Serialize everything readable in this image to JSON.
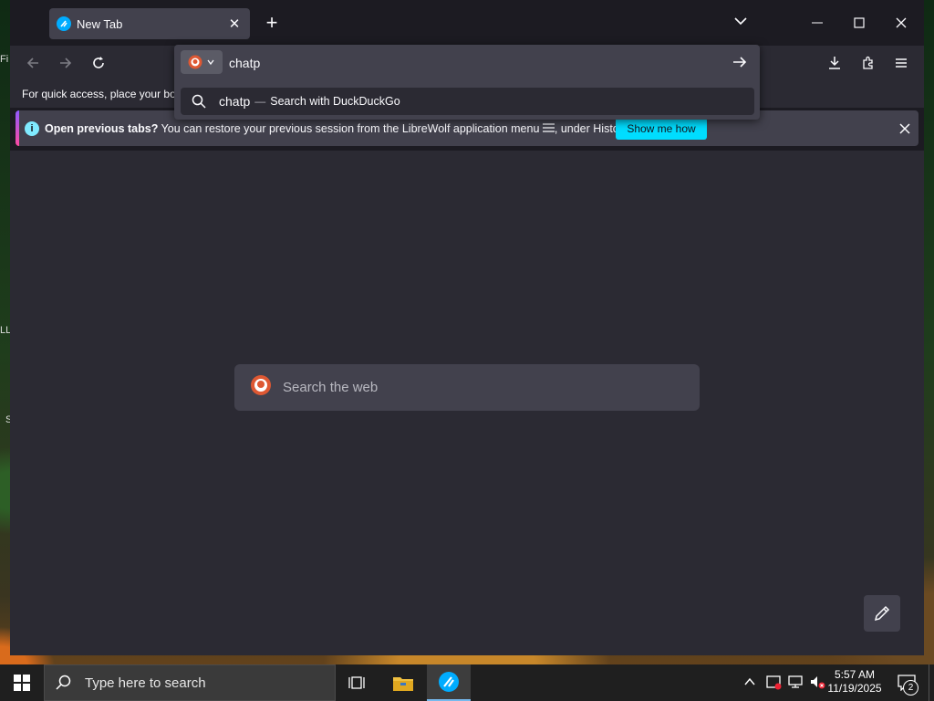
{
  "desktop": {
    "edge_text_1": "Fi",
    "edge_text_2": "LL",
    "edge_text_3": "S"
  },
  "browser": {
    "tab": {
      "title": "New Tab"
    },
    "bookmarks_hint": "For quick access, place your boo",
    "urlbar": {
      "value": "chatp",
      "suggestion_text": "chatp",
      "suggestion_separator": "—",
      "suggestion_action": "Search with DuckDuckGo"
    },
    "notification": {
      "bold": "Open previous tabs?",
      "message_before": " You can restore your previous session from the LibreWolf application menu ",
      "message_after": ", under History.",
      "button": "Show me how"
    },
    "newtab_search": {
      "placeholder": "Search the web"
    }
  },
  "taskbar": {
    "search_placeholder": "Type here to search",
    "time": "5:57 AM",
    "date": "11/19/2025",
    "notification_count": "2"
  },
  "colors": {
    "accent": "#00ddff",
    "tab_active": "#42414d",
    "toolbar": "#2b2a33",
    "frame": "#1c1b22"
  }
}
